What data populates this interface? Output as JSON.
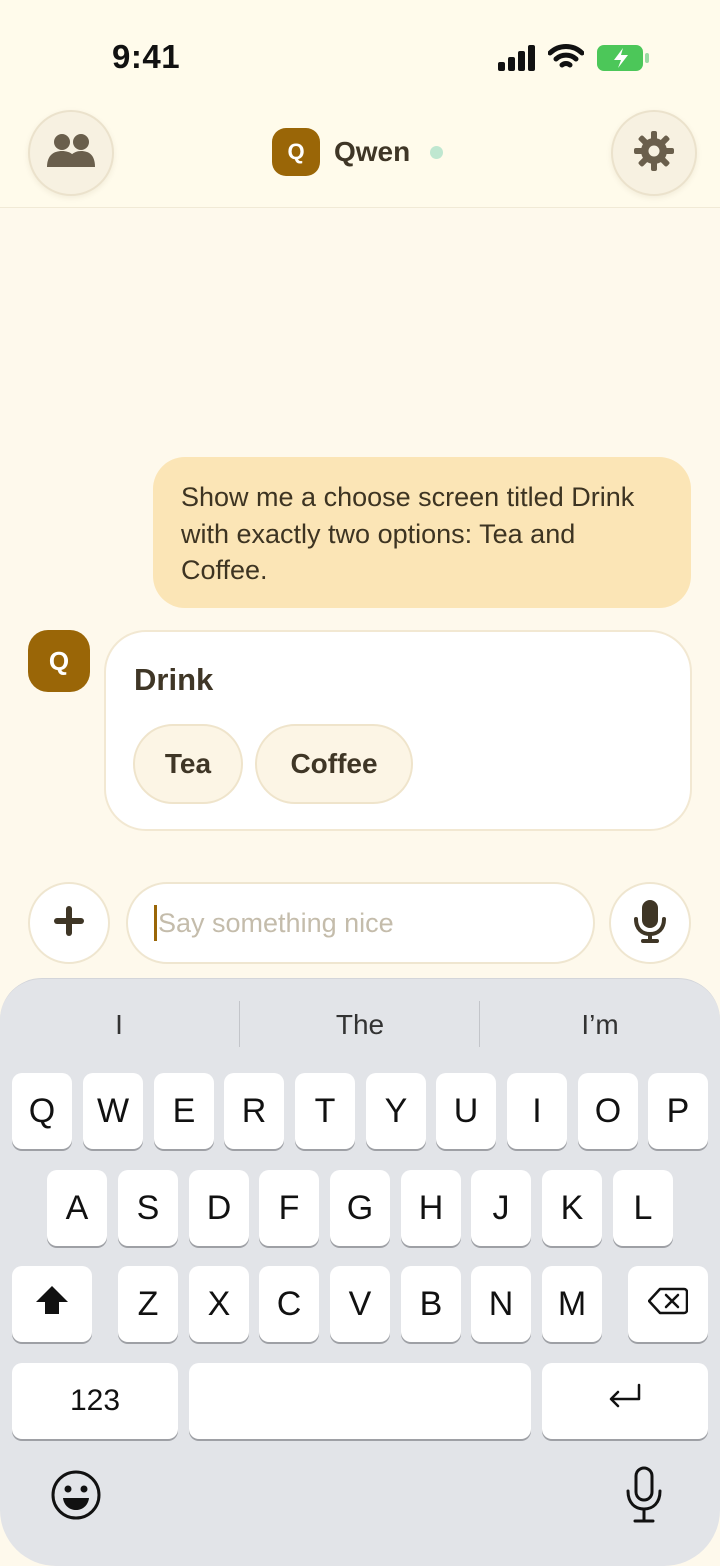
{
  "status_bar": {
    "time": "9:41"
  },
  "header": {
    "avatar_letter": "Q",
    "name": "Qwen",
    "left_icon": "people-icon",
    "right_icon": "gear-icon"
  },
  "messages": {
    "user_text": "Show me a choose screen titled Drink with exactly two options: Tea and Coffee.",
    "bot_avatar_letter": "Q",
    "card": {
      "title": "Drink",
      "options": [
        "Tea",
        "Coffee"
      ]
    }
  },
  "composer": {
    "placeholder": "Say something nice",
    "add_icon": "plus-icon",
    "mic_icon": "microphone-icon"
  },
  "keyboard": {
    "suggestions": [
      "I",
      "The",
      "I’m"
    ],
    "row1": [
      "Q",
      "W",
      "E",
      "R",
      "T",
      "Y",
      "U",
      "I",
      "O",
      "P"
    ],
    "row2": [
      "A",
      "S",
      "D",
      "F",
      "G",
      "H",
      "J",
      "K",
      "L"
    ],
    "row3": [
      "Z",
      "X",
      "C",
      "V",
      "B",
      "N",
      "M"
    ],
    "numbers_key": "123"
  },
  "colors": {
    "accent": "#9a6607",
    "user_bubble": "#fbe5b6",
    "background": "#fef9ec",
    "online": "#bfe7d0"
  }
}
